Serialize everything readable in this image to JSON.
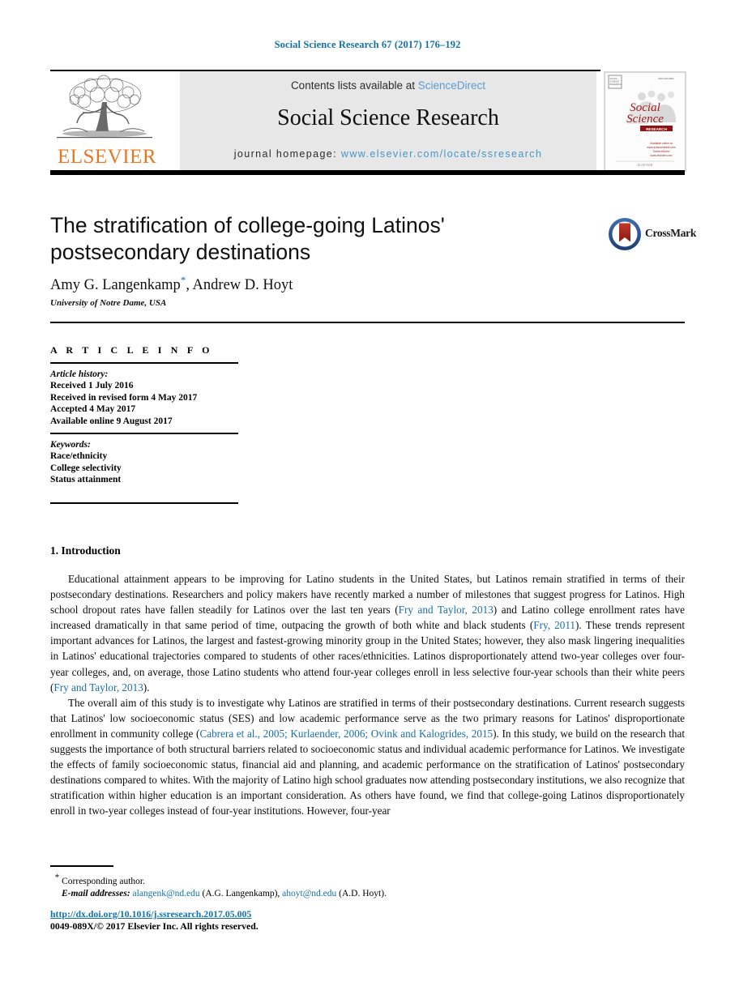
{
  "running_head": "Social Science Research 67 (2017) 176–192",
  "masthead": {
    "contents_prefix": "Contents lists available at ",
    "sciencedirect": "ScienceDirect",
    "journal_title": "Social Science Research",
    "homepage_label": "journal homepage:",
    "homepage_url": "www.elsevier.com/locate/ssresearch",
    "publisher_wordmark": "ELSEVIER",
    "publisher_wordmark_color": "#e87722",
    "sciencedirect_color": "#5b9bd5",
    "homepage_url_color": "#4596c9",
    "banner_bg": "#e7e7e7",
    "cover": {
      "title_line1": "Social",
      "title_line2": "Science",
      "title_line3": "RESEARCH",
      "issn_line": "ISSN 0049-089X",
      "blurb_line1": "Available online at",
      "blurb_line2": "www.sciencedirect.com",
      "blurb_line3": "ScienceDirect",
      "footer": "ELSEVIER"
    }
  },
  "article": {
    "title": "The stratification of college-going Latinos' postsecondary destinations",
    "authors_before_star": "Amy G. Langenkamp",
    "author_star": "*",
    "authors_after_star": ", Andrew D. Hoyt",
    "affiliation": "University of Notre Dame, USA",
    "crossmark_label": "CrossMark"
  },
  "article_info": {
    "heading": "A R T I C L E   I N F O",
    "history_label": "Article history:",
    "history": [
      "Received 1 July 2016",
      "Received in revised form 4 May 2017",
      "Accepted 4 May 2017",
      "Available online 9 August 2017"
    ],
    "keywords_label": "Keywords:",
    "keywords": [
      "Race/ethnicity",
      "College selectivity",
      "Status attainment"
    ]
  },
  "body": {
    "section_title": "1. Introduction",
    "paragraph_1_parts": [
      {
        "t": "Educational attainment appears to be improving for Latino students in the United States, but Latinos remain stratified in terms of their postsecondary destinations. Researchers and policy makers have recently marked a number of milestones that suggest progress for Latinos. High school dropout rates have fallen steadily for Latinos over the last ten years (",
        "link": false
      },
      {
        "t": "Fry and Taylor, 2013",
        "link": true
      },
      {
        "t": ") and Latino college enrollment rates have increased dramatically in that same period of time, outpacing the growth of both white and black students (",
        "link": false
      },
      {
        "t": "Fry, 2011",
        "link": true
      },
      {
        "t": "). These trends represent important advances for Latinos, the largest and fastest-growing minority group in the United States; however, they also mask lingering inequalities in Latinos' educational trajectories compared to students of other races/ethnicities. Latinos disproportionately attend two-year colleges over four-year colleges, and, on average, those Latino students who attend four-year colleges enroll in less selective four-year schools than their white peers (",
        "link": false
      },
      {
        "t": "Fry and Taylor, 2013",
        "link": true
      },
      {
        "t": ").",
        "link": false
      }
    ],
    "paragraph_2_parts": [
      {
        "t": "The overall aim of this study is to investigate why Latinos are stratified in terms of their postsecondary destinations. Current research suggests that Latinos' low socioeconomic status (SES) and low academic performance serve as the two primary reasons for Latinos' disproportionate enrollment in community college (",
        "link": false
      },
      {
        "t": "Cabrera et al., 2005; Kurlaender, 2006; Ovink and Kalogrides, 2015",
        "link": true
      },
      {
        "t": "). In this study, we build on the research that suggests the importance of both structural barriers related to socioeconomic status and individual academic performance for Latinos. We investigate the effects of family socioeconomic status, financial aid and planning, and academic performance on the stratification of Latinos' postsecondary destinations compared to whites. With the majority of Latino high school graduates now attending postsecondary institutions, we also recognize that stratification within higher education is an important consideration. As others have found, we find that college-going Latinos disproportionately enroll in two-year colleges instead of four-year institutions. However, four-year",
        "link": false
      }
    ],
    "citation_link_color": "#1a6fa8"
  },
  "footer": {
    "corresponding_marker": "*",
    "corresponding_text": "Corresponding author.",
    "email_label": "E-mail addresses:",
    "email_1": "alangenk@nd.edu",
    "email_1_owner": "(A.G. Langenkamp),",
    "email_2": "ahoyt@nd.edu",
    "email_2_owner": "(A.D. Hoyt).",
    "doi": "http://dx.doi.org/10.1016/j.ssresearch.2017.05.005",
    "copyright": "0049-089X/© 2017 Elsevier Inc. All rights reserved.",
    "link_color": "#1173a8"
  }
}
